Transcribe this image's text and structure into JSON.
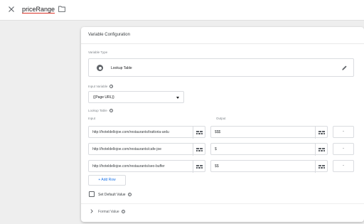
{
  "header": {
    "close_icon": "close-icon",
    "variable_name": "priceRange",
    "folder_icon": "folder-icon"
  },
  "config": {
    "title": "Variable Configuration",
    "variable_type_label": "Variable Type",
    "variable_type_icon": "lookup-table-icon",
    "variable_type": "Lookup Table",
    "edit_icon": "pencil-icon",
    "input_variable_label": "Input Variable",
    "input_variable_value": "{{Page URL}}",
    "lookup_table_label": "Lookup Table",
    "input_col": "Input",
    "output_col": "Output",
    "rows": [
      {
        "input": "http://hoteldellojoe.com/restaurants/trattoria-ardu",
        "output": "$$$"
      },
      {
        "input": "http://hoteldellojoe.com/restaurants/cafe-joe",
        "output": "$"
      },
      {
        "input": "http://hoteldellojoe.com/restaurants/seo-buffer",
        "output": "$$"
      }
    ],
    "add_row_label": "+ Add Row",
    "set_default_label": "Set Default Value",
    "format_value_label": "Format Value",
    "remove_label": "-"
  },
  "colors": {
    "accent": "#1a73e8",
    "underline": "#d93025"
  }
}
